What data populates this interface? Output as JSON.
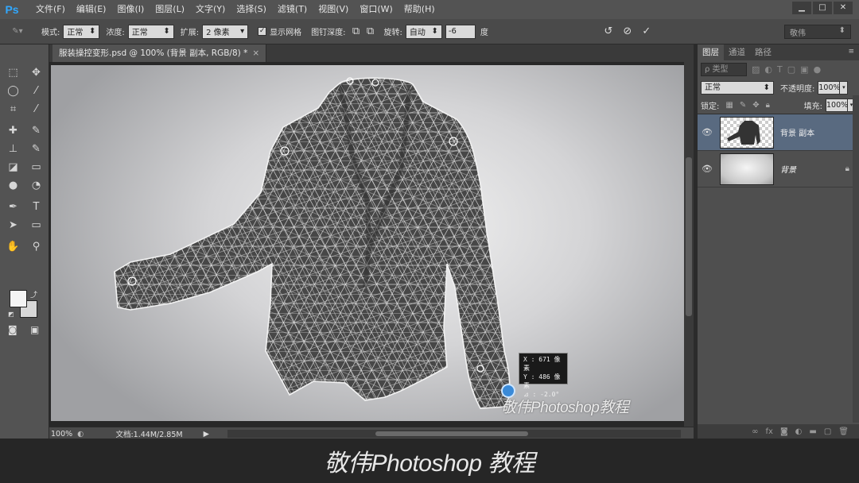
{
  "app": {
    "logo": "Ps"
  },
  "menu": [
    "文件(F)",
    "编辑(E)",
    "图像(I)",
    "图层(L)",
    "文字(Y)",
    "选择(S)",
    "滤镜(T)",
    "视图(V)",
    "窗口(W)",
    "帮助(H)"
  ],
  "window_controls": {
    "minimize": "▁",
    "maximize": "□",
    "close": "✕"
  },
  "options": {
    "mode_label": "模式:",
    "mode_value": "正常",
    "density_label": "浓度:",
    "density_value": "正常",
    "expand_label": "扩展:",
    "expand_value": "2 像素",
    "show_mesh_label": "显示网格",
    "show_mesh_checked": "✓",
    "pin_depth_label": "图钉深度:",
    "rotate_label": "旋转:",
    "rotate_value": "自动",
    "angle_value": "-6",
    "angle_unit": "度",
    "workspace": "敬伟"
  },
  "document": {
    "tab_title": "服装操控变形.psd @ 100% (背景 副本, RGB/8) *",
    "tab_close": "×"
  },
  "info_overlay": {
    "x_line": "X : 671 像素",
    "y_line": "Y : 486 像素",
    "angle_line": "⊿ :     -2.0°"
  },
  "canvas_watermark": "敬伟Photoshop教程",
  "status": {
    "zoom": "100%",
    "doc_size": "文档:1.44M/2.85M"
  },
  "panels": {
    "tabs": [
      "图层",
      "通道",
      "路径"
    ],
    "filter_label": "ρ 类型",
    "blend_mode": "正常",
    "opacity_label": "不透明度:",
    "opacity_value": "100%",
    "lock_label": "锁定:",
    "fill_label": "填充:",
    "fill_value": "100%",
    "layers": [
      {
        "name": "背景 副本"
      },
      {
        "name": "背景"
      }
    ]
  },
  "banner": "敬伟Photoshop 教程"
}
